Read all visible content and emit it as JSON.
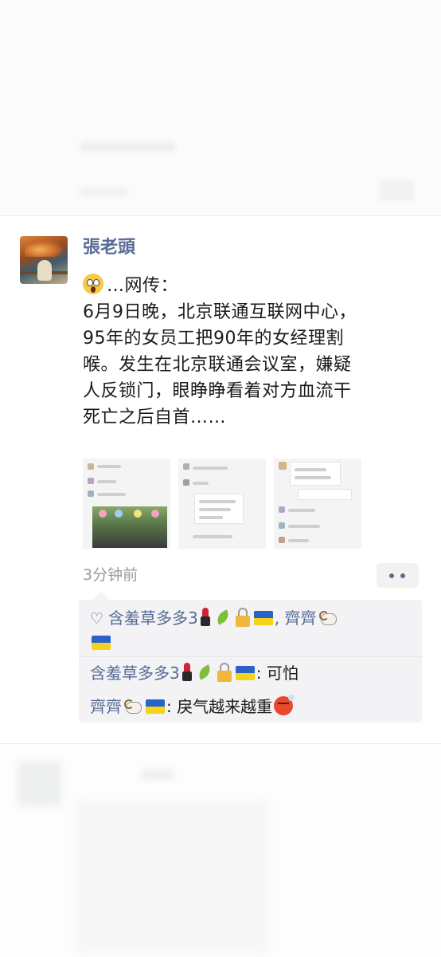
{
  "post": {
    "username": "張老頭",
    "text_lines": [
      "…网传：",
      "6月9日晚，北京联通互联网中心，",
      "95年的女员工把90年的女经理割",
      "喉。发生在北京联通会议室，嫌疑",
      "人反锁门，眼睁睁看着对方血流干",
      "死亡之后自首……"
    ],
    "leading_emoji": "scream-icon",
    "time_ago": "3分钟前",
    "images_count": 3
  },
  "likes": {
    "line1": "含羞草多多3",
    "separator": ",",
    "liker2": "齊齊"
  },
  "comments": [
    {
      "author": "含羞草多多3",
      "text": "可怕"
    },
    {
      "author": "齊齊",
      "text": "戾气越来越重"
    }
  ],
  "colors": {
    "name_blue": "#576b95",
    "text": "#1a1a1a",
    "time_gray": "#9a9a9a",
    "box_bg": "#f3f3f5"
  }
}
